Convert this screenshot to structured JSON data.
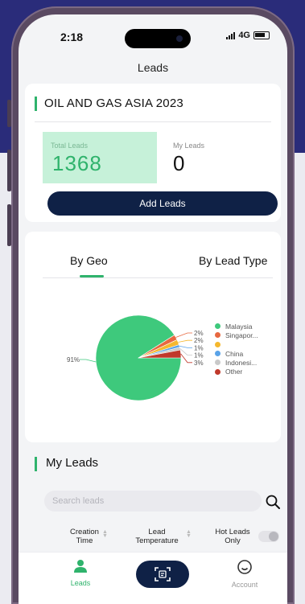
{
  "status_bar": {
    "time": "2:18",
    "network": "4G"
  },
  "header": {
    "title": "Leads"
  },
  "event": {
    "name": "OIL AND GAS ASIA 2023",
    "total_leads_label": "Total Leads",
    "total_leads_value": "1368",
    "my_leads_label": "My Leads",
    "my_leads_value": "0",
    "add_button_label": "Add Leads"
  },
  "tabs": [
    {
      "label": "By Geo",
      "selected": true
    },
    {
      "label": "By Lead Type",
      "selected": false
    }
  ],
  "chart_data": {
    "type": "pie",
    "slices": [
      {
        "label": "Malaysia",
        "value": 91,
        "display": "91%",
        "color": "#3ec97c"
      },
      {
        "label": "Singapor...",
        "value": 2,
        "display": "2%",
        "color": "#e76840"
      },
      {
        "label": "",
        "value": 2,
        "display": "2%",
        "color": "#f5b82e"
      },
      {
        "label": "China",
        "value": 1,
        "display": "1%",
        "color": "#5aa3e8"
      },
      {
        "label": "Indonesi...",
        "value": 1,
        "display": "1%",
        "color": "#c9c9c9"
      },
      {
        "label": "Other",
        "value": 3,
        "display": "3%",
        "color": "#c0392b"
      }
    ],
    "legend_position": "right"
  },
  "my_leads": {
    "title": "My Leads",
    "search_placeholder": "Search leads",
    "filters": {
      "creation_time": "Creation\nTime",
      "lead_temperature": "Lead\nTemperature",
      "hot_leads_only": "Hot Leads\nOnly"
    },
    "hot_leads_toggle": false
  },
  "tabbar": {
    "leads_label": "Leads",
    "account_label": "Account"
  },
  "colors": {
    "accent": "#2fb36c",
    "navy": "#0f2146",
    "background_top": "#2a2c7a"
  }
}
